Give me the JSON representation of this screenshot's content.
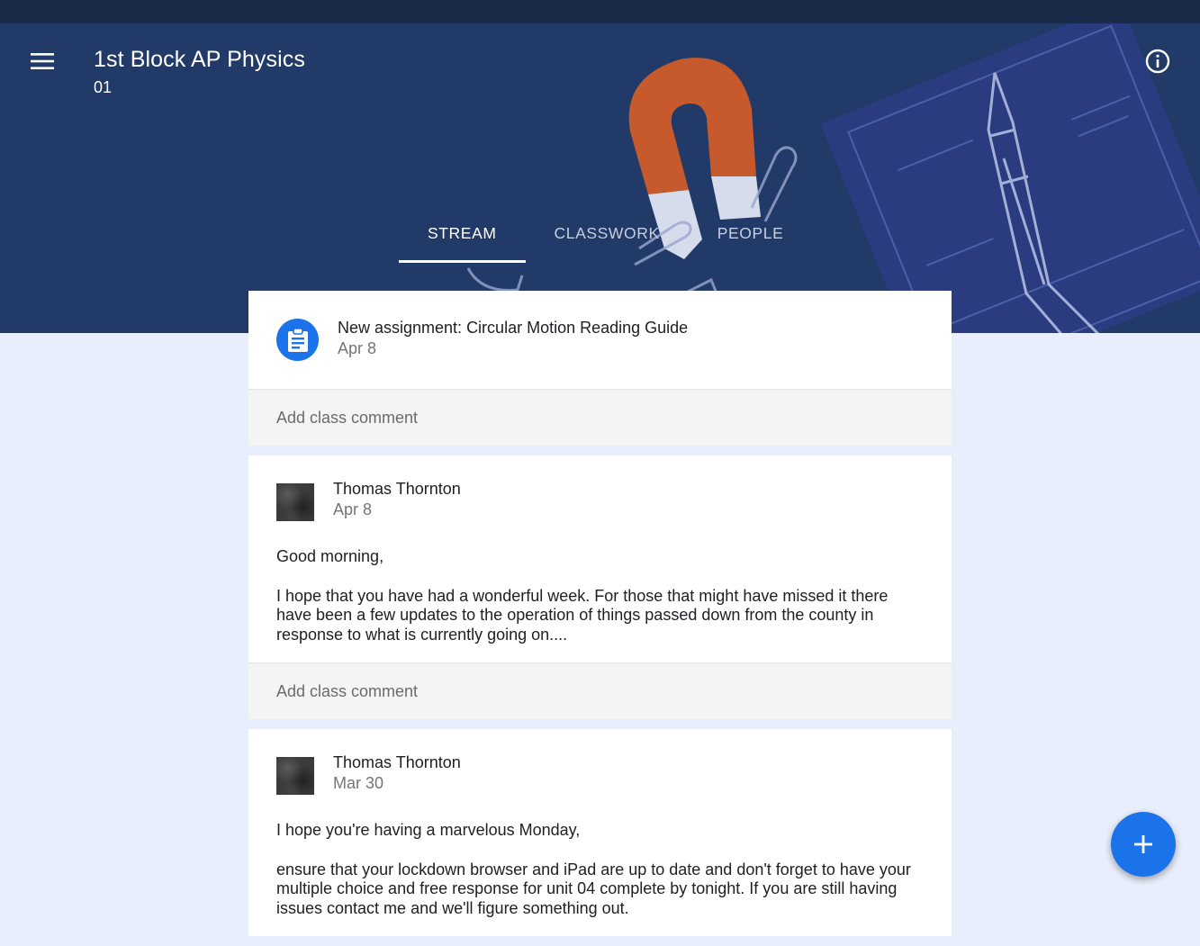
{
  "header": {
    "title": "1st Block AP Physics",
    "section": "01"
  },
  "tabs": [
    {
      "label": "STREAM",
      "active": true
    },
    {
      "label": "CLASSWORK",
      "active": false
    },
    {
      "label": "PEOPLE",
      "active": false
    }
  ],
  "assignment": {
    "prefix": "New assignment: ",
    "title": "Circular Motion Reading Guide",
    "date": "Apr 8",
    "comment_placeholder": "Add class comment"
  },
  "posts": [
    {
      "author": "Thomas Thornton",
      "date": "Apr 8",
      "paragraphs": [
        "Good morning,",
        "I hope that you have had a wonderful week. For those that might have missed it there have been a few updates to the operation of things passed down from the county in response to what is currently going on...."
      ],
      "comment_placeholder": "Add class comment"
    },
    {
      "author": "Thomas Thornton",
      "date": "Mar 30",
      "paragraphs": [
        "I hope you're having a marvelous Monday,",
        "ensure that your lockdown browser and iPad are up to date and don't forget to have your multiple choice and free response for unit 04 complete by tonight. If you are still having issues contact me and we'll figure something out."
      ]
    }
  ],
  "colors": {
    "header_bg": "#213a67",
    "accent": "#1a73e8",
    "page_bg": "#e8eefc"
  },
  "icons": {
    "menu": "hamburger-menu-icon",
    "info": "info-icon",
    "assignment": "clipboard-icon",
    "fab": "plus-icon"
  }
}
